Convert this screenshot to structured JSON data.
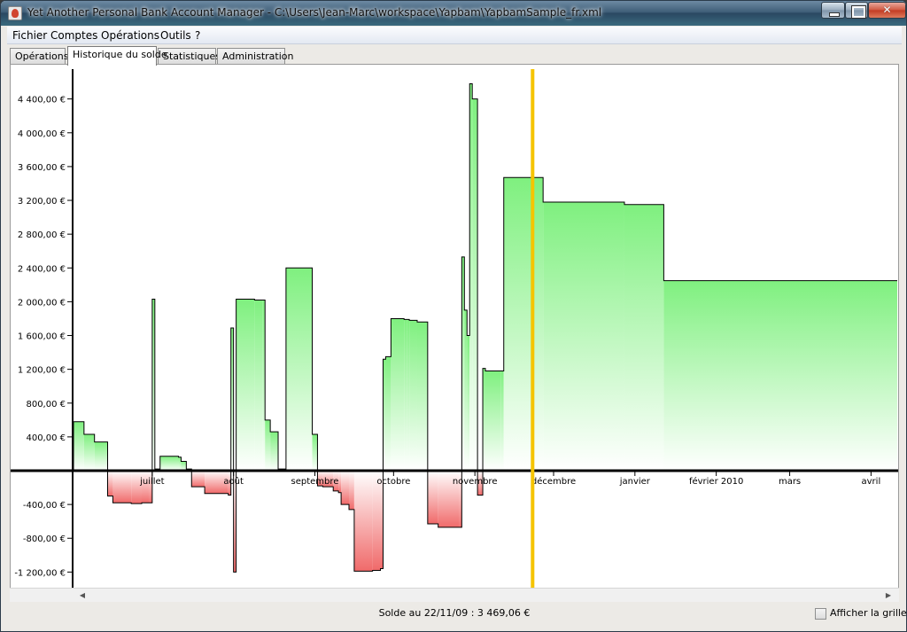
{
  "window": {
    "title": "Yet Another Personal Bank Account Manager - C:\\Users\\Jean-Marc\\workspace\\Yapbam\\YapbamSample_fr.xml",
    "app_icon": "java-cup-icon",
    "controls": [
      "minimize-icon",
      "maximize-icon",
      "close-icon"
    ]
  },
  "menubar": {
    "items": [
      "Fichier",
      "Comptes",
      "Opérations",
      "Outils",
      "?"
    ]
  },
  "tabs": [
    {
      "label": "Opérations",
      "active": false
    },
    {
      "label": "Historique du solde",
      "active": true
    },
    {
      "label": "Statistiques",
      "active": false
    },
    {
      "label": "Administration",
      "active": false
    }
  ],
  "colors": {
    "positive_fill_top": "#88f088",
    "positive_fill_bottom": "#ffffff",
    "negative_fill": "#f06a6a",
    "today_line": "#f5c400",
    "axis": "#000000"
  },
  "chart_data": {
    "type": "area",
    "ylim": [
      -1300,
      4600
    ],
    "y_ticks": [
      -1200,
      -800,
      -400,
      400,
      800,
      1200,
      1600,
      2000,
      2400,
      2800,
      3200,
      3600,
      4000,
      4400
    ],
    "y_tick_labels": [
      "-1 200,00 €",
      "-800,00 €",
      "-400,00 €",
      "400,00 €",
      "800,00 €",
      "1 200,00 €",
      "1 600,00 €",
      "2 000,00 €",
      "2 400,00 €",
      "2 800,00 €",
      "3 200,00 €",
      "3 600,00 €",
      "4 000,00 €",
      "4 400,00 €"
    ],
    "x_ticks": [
      {
        "label": "juillet",
        "day": 30
      },
      {
        "label": "août",
        "day": 61
      },
      {
        "label": "septembre",
        "day": 92
      },
      {
        "label": "octobre",
        "day": 122
      },
      {
        "label": "novembre",
        "day": 153
      },
      {
        "label": "décembre",
        "day": 183
      },
      {
        "label": "janvier",
        "day": 214
      },
      {
        "label": "février 2010",
        "day": 245
      },
      {
        "label": "mars",
        "day": 273
      },
      {
        "label": "avril",
        "day": 304
      }
    ],
    "xlim": [
      0,
      314
    ],
    "today_day": 175,
    "grid": false,
    "steps": [
      [
        0,
        580
      ],
      [
        4,
        430
      ],
      [
        8,
        340
      ],
      [
        12,
        340
      ],
      [
        13,
        -300
      ],
      [
        15,
        -380
      ],
      [
        22,
        -390
      ],
      [
        26,
        -380
      ],
      [
        29,
        -380
      ],
      [
        30,
        2030
      ],
      [
        31,
        20
      ],
      [
        33,
        170
      ],
      [
        40,
        160
      ],
      [
        41,
        110
      ],
      [
        43,
        20
      ],
      [
        45,
        -190
      ],
      [
        50,
        -270
      ],
      [
        59,
        -290
      ],
      [
        60,
        1690
      ],
      [
        61,
        -1200
      ],
      [
        62,
        2030
      ],
      [
        69,
        2020
      ],
      [
        72,
        2020
      ],
      [
        73,
        600
      ],
      [
        75,
        460
      ],
      [
        78,
        20
      ],
      [
        81,
        2400
      ],
      [
        91,
        430
      ],
      [
        93,
        -180
      ],
      [
        95,
        -190
      ],
      [
        99,
        -240
      ],
      [
        101,
        -260
      ],
      [
        102,
        -400
      ],
      [
        105,
        -460
      ],
      [
        107,
        -1190
      ],
      [
        114,
        -1180
      ],
      [
        117,
        -1160
      ],
      [
        118,
        1320
      ],
      [
        119,
        1350
      ],
      [
        121,
        1800
      ],
      [
        126,
        1790
      ],
      [
        127,
        1790
      ],
      [
        128,
        1780
      ],
      [
        131,
        1760
      ],
      [
        135,
        -630
      ],
      [
        139,
        -670
      ],
      [
        147,
        -670
      ],
      [
        148,
        2530
      ],
      [
        149,
        1900
      ],
      [
        150,
        1600
      ],
      [
        151,
        4580
      ],
      [
        152,
        4400
      ],
      [
        154,
        -290
      ],
      [
        156,
        1210
      ],
      [
        157,
        1180
      ],
      [
        163,
        1180
      ],
      [
        164,
        3470
      ],
      [
        179,
        3180
      ],
      [
        210,
        3150
      ],
      [
        225,
        2250
      ],
      [
        314,
        2250
      ]
    ]
  },
  "status": {
    "text": "Solde au 22/11/09 : 3 469,06 €",
    "grid_label": "Afficher la grille",
    "grid_checked": false
  }
}
